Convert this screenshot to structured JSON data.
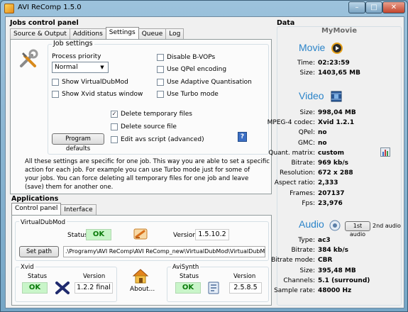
{
  "window": {
    "title": "AVI ReComp  1.5.0"
  },
  "caption_buttons": {
    "minimize": "–",
    "maximize": "□",
    "close": "✕"
  },
  "jobs": {
    "title": "Jobs control panel",
    "tabs": [
      "Source & Output",
      "Additions",
      "Settings",
      "Queue",
      "Log"
    ],
    "active_tab": "Settings",
    "job_settings_title": "Job settings",
    "process_priority_label": "Process priority",
    "process_priority_value": "Normal",
    "checks": {
      "show_vdm": "Show VirtualDubMod",
      "show_xvid": "Show Xvid status window",
      "disable_bvops": "Disable B-VOPs",
      "qpel": "Use QPel encoding",
      "adaptive_quant": "Use Adaptive Quantisation",
      "turbo": "Use Turbo mode",
      "delete_temp": "Delete temporary files",
      "delete_source": "Delete source file",
      "edit_avs": "Edit avs script (advanced)"
    },
    "checked": {
      "delete_temp": "✓"
    },
    "program_defaults": "Program defaults",
    "help_icon": "?",
    "info_lines": [
      "All these settings are specific for one job. This way you are able to set a specific",
      "action for each job. For example you can use Turbo mode just for some of",
      "your jobs. You can force deleting all temporary files for one job and leave",
      "(save) them for another one."
    ]
  },
  "applications": {
    "title": "Applications",
    "tabs": [
      "Control panel",
      "Interface"
    ],
    "active_tab": "Control panel",
    "vdm": {
      "title": "VirtualDubMod",
      "status_label": "Status",
      "status": "OK",
      "version_label": "Version",
      "version": "1.5.10.2",
      "set_path": "Set path",
      "path": ".\\Programy\\AVI ReComp\\AVI ReComp_new\\VirtualDubMod\\VirtualDubMod.exe"
    },
    "xvid": {
      "title": "Xvid",
      "status_label": "Status",
      "status": "OK",
      "version_label": "Version",
      "version": "1.2.2 final"
    },
    "about": "About...",
    "avisynth": {
      "title": "AviSynth",
      "status_label": "Status",
      "status": "OK",
      "version_label": "Version",
      "version": "2.5.8.5"
    }
  },
  "data": {
    "title": "Data",
    "movie_name": "MyMovie",
    "movie_head": "Movie",
    "movie": [
      {
        "label": "Time:",
        "value": "02:23:59"
      },
      {
        "label": "Size:",
        "value": "1403,65 MB"
      }
    ],
    "video_head": "Video",
    "video": [
      {
        "label": "Size:",
        "value": "998,04 MB"
      },
      {
        "label": "MPEG-4 codec:",
        "value": "Xvid 1.2.1"
      },
      {
        "label": "QPel:",
        "value": "no"
      },
      {
        "label": "GMC:",
        "value": "no"
      },
      {
        "label": "Quant. matrix:",
        "value": "custom"
      },
      {
        "label": "Bitrate:",
        "value": "969 kb/s"
      },
      {
        "label": "Resolution:",
        "value": "672 x 288"
      },
      {
        "label": "Aspect ratio:",
        "value": "2,333"
      },
      {
        "label": "Frames:",
        "value": "207137"
      },
      {
        "label": "Fps:",
        "value": "23,976"
      }
    ],
    "audio_head": "Audio",
    "audio_1st": "1st audio",
    "audio_2nd": "2nd audio",
    "audio": [
      {
        "label": "Type:",
        "value": "ac3"
      },
      {
        "label": "Bitrate:",
        "value": "384 kb/s"
      },
      {
        "label": "Bitrate mode:",
        "value": "CBR"
      },
      {
        "label": "Size:",
        "value": "395,48 MB"
      },
      {
        "label": "Channels:",
        "value": "5.1 (surround)"
      },
      {
        "label": "Sample rate:",
        "value": "48000 Hz"
      }
    ]
  },
  "colors": {
    "accent": "#2b84c9",
    "ok_bg": "#c9f5c9",
    "ok_text": "#0a7a0a"
  }
}
